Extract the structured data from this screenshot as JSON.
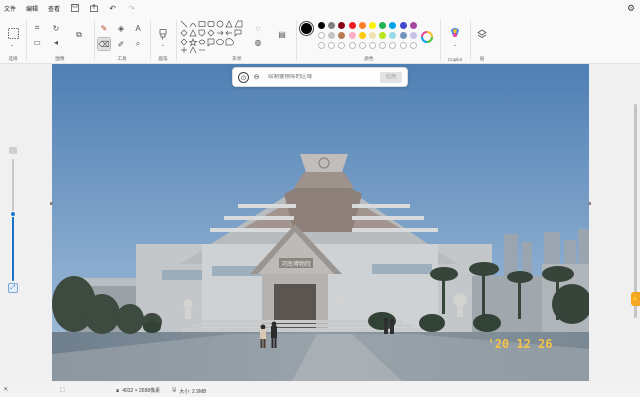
{
  "menu": {
    "file": "文件",
    "edit": "编辑",
    "view": "查看"
  },
  "ribbon": {
    "groups": {
      "select": "选择",
      "image": "图像",
      "tools": "工具",
      "brushes": "画笔",
      "shapes": "形状",
      "colors": "颜色",
      "copilot": "Copilot",
      "layers": "层"
    },
    "text_tool_glyph": "A",
    "colors": {
      "primary": "#000000",
      "row1": [
        "#000000",
        "#7f7f7f",
        "#880015",
        "#ed1c24",
        "#ff7f27",
        "#fff200",
        "#22b14c",
        "#00a2e8",
        "#3f48cc",
        "#a349a4"
      ],
      "row2": [
        "#ffffff",
        "#c3c3c3",
        "#b97a57",
        "#ffaec9",
        "#ffc90e",
        "#efe4b0",
        "#b5e61d",
        "#99d9ea",
        "#7092be",
        "#c8bfe7"
      ],
      "row3_empty": 10
    }
  },
  "prompt": {
    "placeholder": "绘制要擦除的区域",
    "apply_label": "应用"
  },
  "photo": {
    "date_stamp": "'20 12 26",
    "sign": "河南博物院"
  },
  "zoom": {
    "level_fraction": 0.55
  },
  "status": {
    "dimensions": "4032 × 2688像素",
    "size": "大小: 2.9MB"
  },
  "colors": {
    "accent": "#1a73c9",
    "sky_top": "#4f7fb4",
    "sky_bottom": "#a9c3dc",
    "date_stamp": "#f5c24a"
  }
}
